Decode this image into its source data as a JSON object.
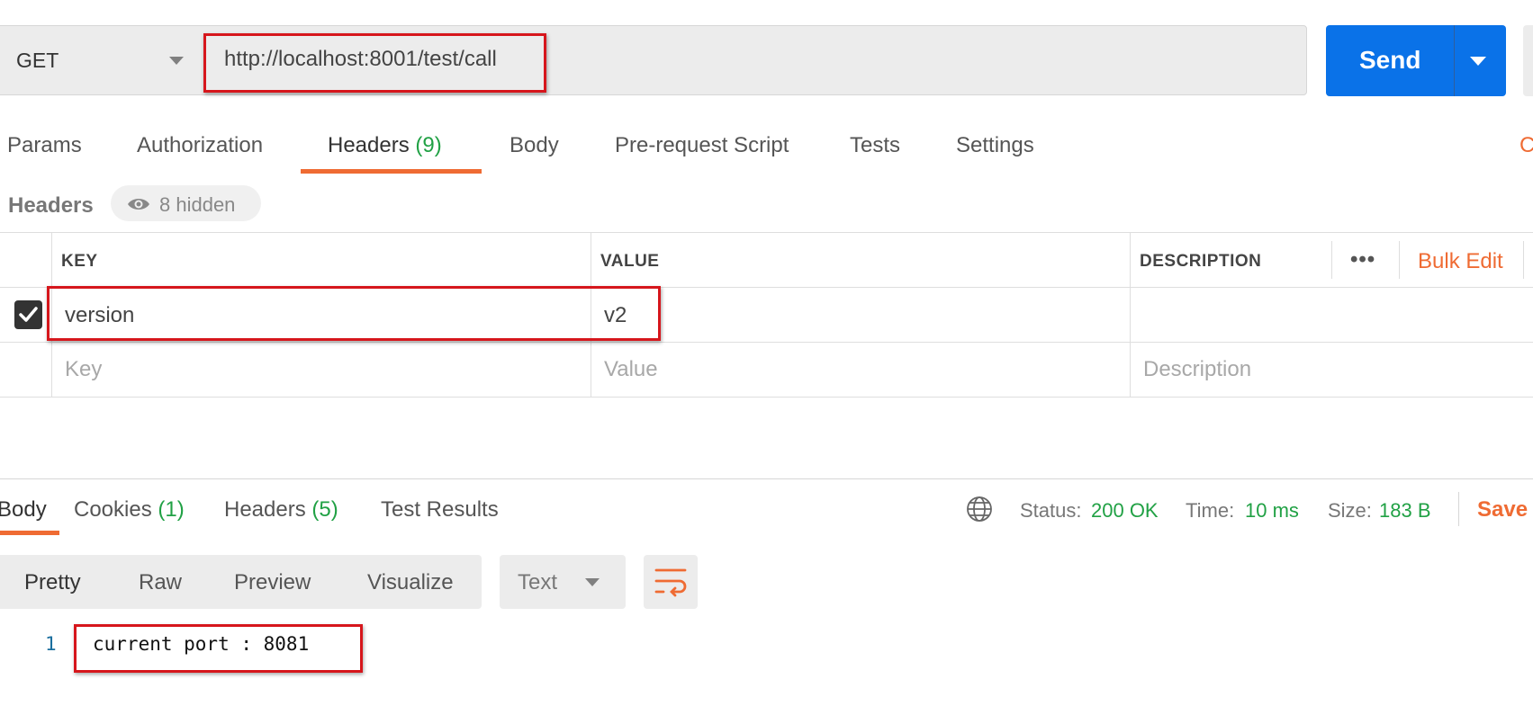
{
  "request": {
    "method": "GET",
    "url": "http://localhost:8001/test/call",
    "send_label": "Send"
  },
  "request_tabs": [
    {
      "label": "Params"
    },
    {
      "label": "Authorization"
    },
    {
      "label": "Headers",
      "count": "(9)"
    },
    {
      "label": "Body"
    },
    {
      "label": "Pre-request Script"
    },
    {
      "label": "Tests"
    },
    {
      "label": "Settings"
    }
  ],
  "cookies_stub": "C",
  "headers_section": {
    "title": "Headers",
    "hidden_label": "8 hidden",
    "columns": {
      "key": "KEY",
      "value": "VALUE",
      "description": "DESCRIPTION"
    },
    "more_label": "•••",
    "bulk_edit": "Bulk Edit",
    "rows": [
      {
        "checked": true,
        "key": "version",
        "value": "v2",
        "description": ""
      }
    ],
    "placeholders": {
      "key": "Key",
      "value": "Value",
      "description": "Description"
    }
  },
  "response_tabs": [
    {
      "label": "Body"
    },
    {
      "label": "Cookies",
      "count": "(1)"
    },
    {
      "label": "Headers",
      "count": "(5)"
    },
    {
      "label": "Test Results"
    }
  ],
  "status": {
    "status_label": "Status:",
    "status_value": "200 OK",
    "time_label": "Time:",
    "time_value": "10 ms",
    "size_label": "Size:",
    "size_value": "183 B",
    "save_label": "Save"
  },
  "view_options": [
    "Pretty",
    "Raw",
    "Preview",
    "Visualize"
  ],
  "format": "Text",
  "response_body": [
    {
      "line": "1",
      "text": "current port : 8081"
    }
  ],
  "colors": {
    "accent": "#ef6b33",
    "send": "#0a72e8",
    "success": "#21a145",
    "highlight": "#d6161c"
  },
  "icons": [
    "chevron-down-icon",
    "eye-icon",
    "checkmark-icon",
    "globe-icon",
    "wrap-icon"
  ]
}
